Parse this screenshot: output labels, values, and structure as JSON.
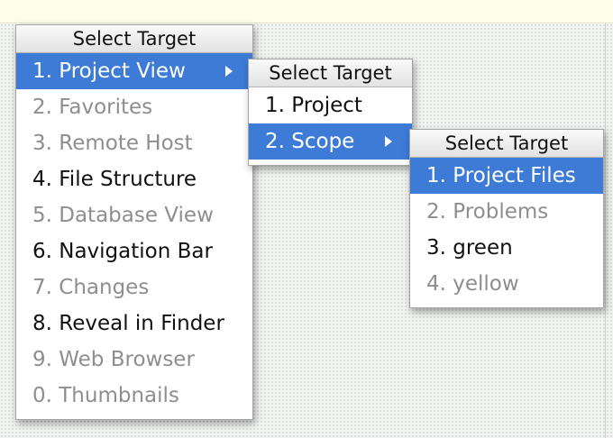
{
  "colors": {
    "selection": "#3d7bd6",
    "disabled_text": "#8e8e8e",
    "editor_top": "#fdfdea"
  },
  "menus": [
    {
      "header": "Select Target",
      "items": [
        {
          "label": "1. Project View",
          "state": "selected",
          "submenu": true
        },
        {
          "label": "2. Favorites",
          "state": "disabled"
        },
        {
          "label": "3. Remote Host",
          "state": "disabled"
        },
        {
          "label": "4. File Structure",
          "state": "enabled"
        },
        {
          "label": "5. Database View",
          "state": "disabled"
        },
        {
          "label": "6. Navigation Bar",
          "state": "enabled"
        },
        {
          "label": "7. Changes",
          "state": "disabled"
        },
        {
          "label": "8. Reveal in Finder",
          "state": "enabled"
        },
        {
          "label": "9. Web Browser",
          "state": "disabled"
        },
        {
          "label": "0. Thumbnails",
          "state": "disabled"
        }
      ]
    },
    {
      "header": "Select Target",
      "items": [
        {
          "label": "1. Project",
          "state": "enabled"
        },
        {
          "label": "2. Scope",
          "state": "selected",
          "submenu": true
        }
      ]
    },
    {
      "header": "Select Target",
      "items": [
        {
          "label": "1. Project Files",
          "state": "selected"
        },
        {
          "label": "2. Problems",
          "state": "disabled"
        },
        {
          "label": "3. green",
          "state": "enabled"
        },
        {
          "label": "4. yellow",
          "state": "disabled"
        }
      ]
    }
  ]
}
